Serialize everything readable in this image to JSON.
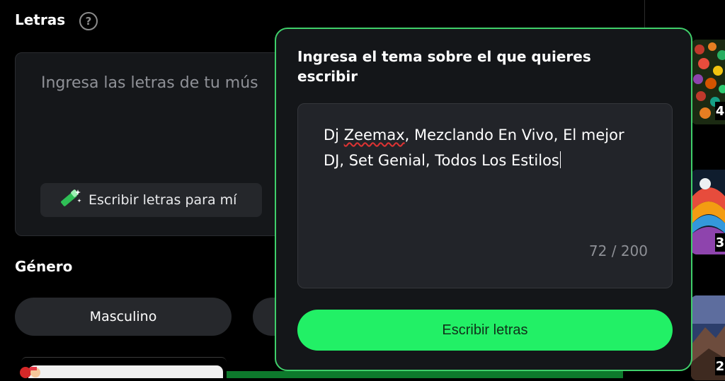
{
  "lyrics_section": {
    "title": "Letras",
    "help_icon": "question-circle-icon",
    "placeholder": "Ingresa las letras de tu mús",
    "write_for_me_label": "Escribir letras para mí",
    "write_for_me_icon": "magic-wand-icon"
  },
  "genre_section": {
    "title": "Género",
    "options": [
      {
        "label": "Masculino"
      }
    ]
  },
  "topic_popup": {
    "title": "Ingresa el tema sobre el que quieres escribir",
    "topic_value_part1": "Dj ",
    "topic_value_misspelled": "Zeemax",
    "topic_value_part2": ", Mezclando En Vivo, El mejor DJ, Set Genial, Todos Los Estilos",
    "counter": "72 / 200",
    "submit_label": "Escribir letras"
  },
  "thumbnails": [
    {
      "count": "4"
    },
    {
      "count": "3"
    },
    {
      "count": "2"
    }
  ],
  "colors": {
    "accent_green": "#22f066",
    "popup_border": "#3fcf6a",
    "background": "#000000",
    "panel": "#15171a"
  }
}
